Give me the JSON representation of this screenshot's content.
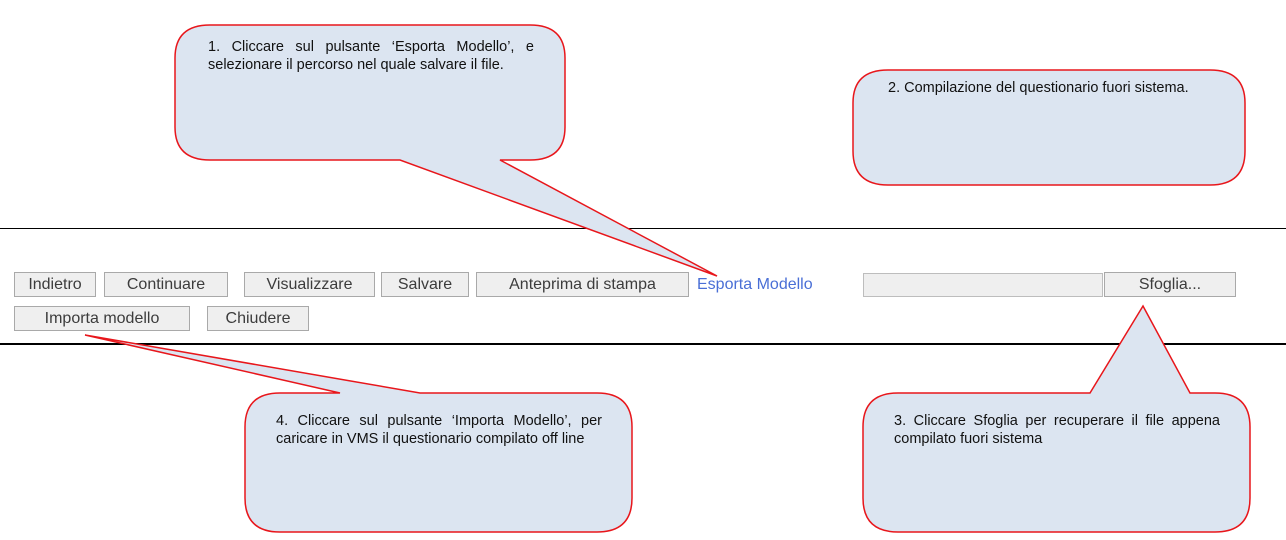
{
  "toolbar": {
    "back_label": "Indietro",
    "continue_label": "Continuare",
    "view_label": "Visualizzare",
    "save_label": "Salvare",
    "print_preview_label": "Anteprima di stampa",
    "export_model_label": "Esporta Modello",
    "browse_label": "Sfoglia...",
    "import_model_label": "Importa modello",
    "close_label": "Chiudere"
  },
  "callouts": {
    "step1": "1. Cliccare sul pulsante ‘Esporta Modello’, e selezionare il percorso nel quale salvare il file.",
    "step2": "2. Compilazione del questionario fuori sistema.",
    "step3": "3. Cliccare Sfoglia per recuperare il file appena compilato fuori sistema",
    "step4": "4. Cliccare sul pulsante ‘Importa Modello’, per caricare in VMS il questionario compilato off line"
  },
  "colors": {
    "callout_fill": "#dce5f1",
    "callout_border": "#e8161b",
    "link": "#4a6fd6",
    "button_bg": "#efefef"
  }
}
